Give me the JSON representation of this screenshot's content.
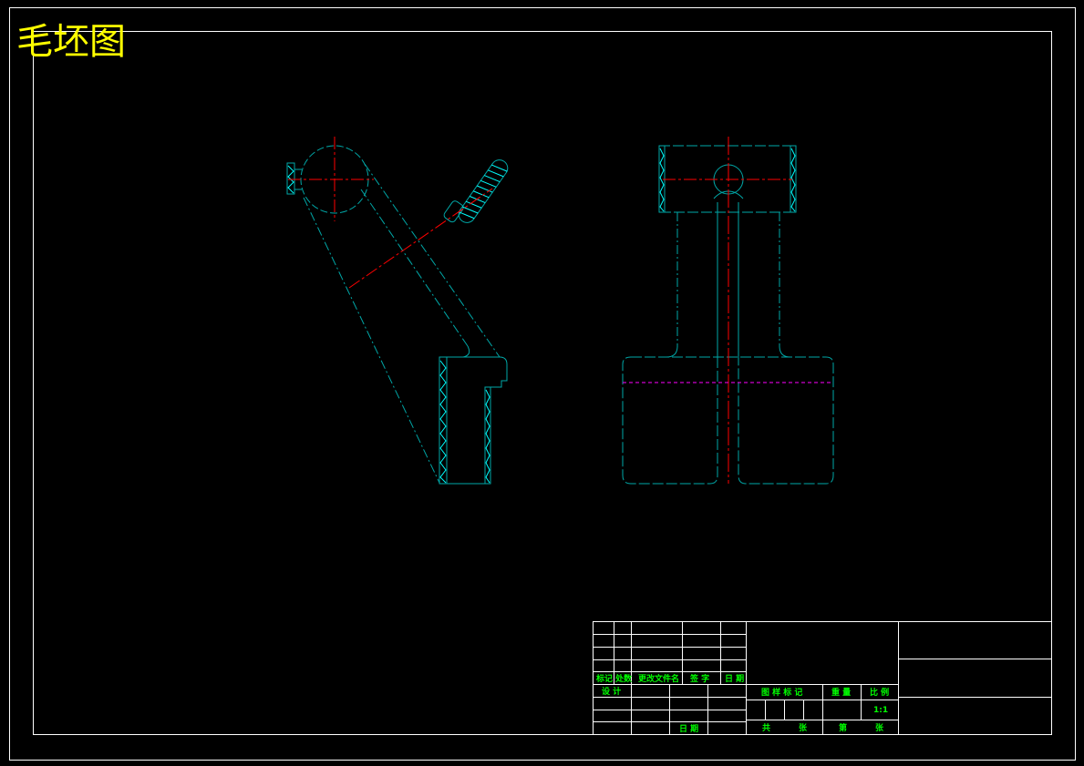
{
  "drawing": {
    "title": "毛坯图",
    "colors": {
      "background": "#000000",
      "frame": "#ffffff",
      "outline": "#00a7a7",
      "hatch": "#00ffff",
      "center_line": "#ff0000",
      "parting_line": "#ff00ff",
      "title_text": "#ffff00",
      "block_text": "#00ff00"
    }
  },
  "title_block": {
    "rev_headers": [
      "标记",
      "处数",
      "更改文件名",
      "签 字",
      "日 期"
    ],
    "design_label": "设 计",
    "date_label": "日 期",
    "stage_mark": "图 样 标 记",
    "weight": "重 量",
    "scale_label": "比 例",
    "scale_value": "1:1",
    "sheets_total": "共",
    "sheets_unit": "张",
    "sheet_no": "第",
    "sheet_unit": "张"
  }
}
